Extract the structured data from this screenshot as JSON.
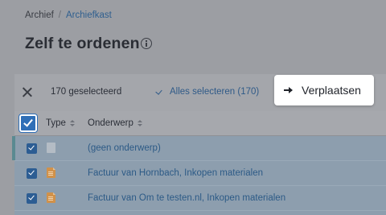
{
  "breadcrumb": {
    "root": "Archief",
    "separator": "/",
    "current": "Archiefkast"
  },
  "page": {
    "title": "Zelf te ordenen",
    "info_icon": "info-circle-icon"
  },
  "toolbar": {
    "selected_count": "170 geselecteerd",
    "select_all_label": "Alles selecteren (170)",
    "move_label": "Verplaatsen"
  },
  "table": {
    "columns": [
      {
        "label": "Type"
      },
      {
        "label": "Onderwerp"
      }
    ],
    "rows": [
      {
        "type": "blank",
        "subject": "(geen onderwerp)",
        "checked": true
      },
      {
        "type": "document",
        "subject": "Factuur van Hornbach, Inkopen materialen",
        "checked": true
      },
      {
        "type": "document",
        "subject": "Factuur van Om te testen.nl, Inkopen materialen",
        "checked": true
      }
    ]
  },
  "colors": {
    "accent": "#2f6fb7",
    "link": "#2f5a88",
    "overlay": "#9c9ea3",
    "selected_row": "#8d9eae"
  }
}
